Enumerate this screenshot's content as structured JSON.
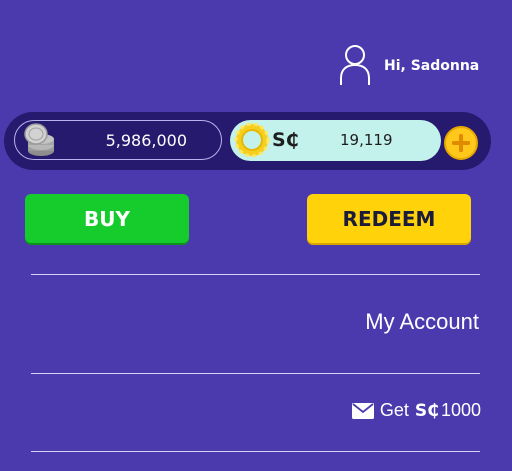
{
  "header": {
    "greeting": "Hi, Sadonna",
    "avatar_icon": "user-icon"
  },
  "balances": {
    "gold_coins": {
      "icon": "silver-coin-stack-icon",
      "amount": "5,986,000"
    },
    "sweeps_coins": {
      "icon": "gold-coin-icon",
      "symbol": "S₵",
      "amount": "19,119"
    },
    "add_icon": "plus-circle-icon"
  },
  "actions": {
    "buy_label": "BUY",
    "redeem_label": "REDEEM"
  },
  "menu": {
    "my_account_label": "My Account",
    "promo": {
      "icon": "mail-icon",
      "prefix": "Get",
      "symbol": "S₵",
      "amount": "1000"
    }
  },
  "colors": {
    "background": "#4a3aae",
    "bar": "#251a6e",
    "sc_pill": "#c3f2ec",
    "buy": "#16cc2d",
    "redeem": "#ffd20a",
    "add": "#ffc81a"
  }
}
